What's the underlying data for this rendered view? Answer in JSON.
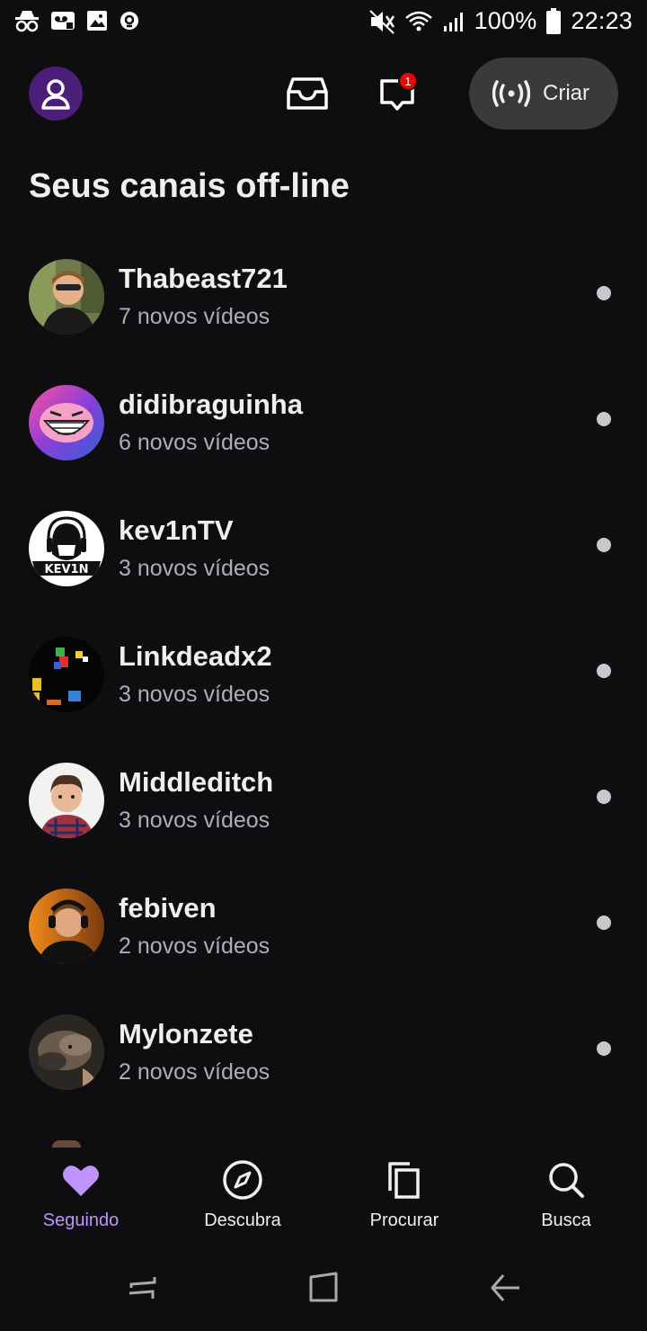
{
  "status_bar": {
    "battery": "100%",
    "time": "22:23",
    "left_icons": [
      "incognito-icon",
      "voicemail-icon",
      "image-icon",
      "sync-icon"
    ],
    "right_icons": [
      "mute-vibrate-icon",
      "wifi-icon",
      "signal-icon",
      "battery-icon"
    ]
  },
  "header": {
    "create_label": "Criar",
    "notification_count": "1",
    "accent_color": "#9147ff"
  },
  "section_title": "Seus canais off-line",
  "channels": [
    {
      "name": "Thabeast721",
      "subtitle": "7 novos vídeos"
    },
    {
      "name": "didibraguinha",
      "subtitle": "6 novos vídeos"
    },
    {
      "name": "kev1nTV",
      "subtitle": "3 novos vídeos",
      "avatar_text": "KEV1N"
    },
    {
      "name": "Linkdeadx2",
      "subtitle": "3 novos vídeos"
    },
    {
      "name": "Middleditch",
      "subtitle": "3 novos vídeos"
    },
    {
      "name": "febiven",
      "subtitle": "2 novos vídeos"
    },
    {
      "name": "Mylonzete",
      "subtitle": "2 novos vídeos"
    }
  ],
  "bottom_nav": [
    {
      "label": "Seguindo",
      "icon": "heart-icon",
      "active": true
    },
    {
      "label": "Descubra",
      "icon": "compass-icon",
      "active": false
    },
    {
      "label": "Procurar",
      "icon": "browse-icon",
      "active": false
    },
    {
      "label": "Busca",
      "icon": "search-icon",
      "active": false
    }
  ],
  "system_nav": [
    "recents-icon",
    "home-icon",
    "back-icon"
  ]
}
